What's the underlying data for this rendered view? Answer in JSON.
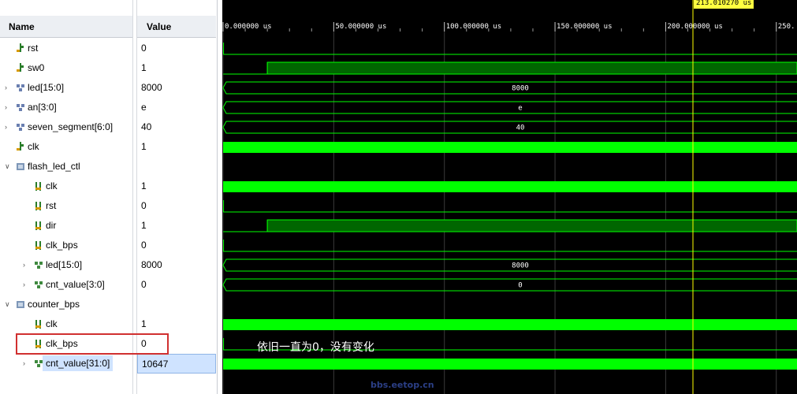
{
  "columns": {
    "name": "Name",
    "value": "Value"
  },
  "signals": [
    {
      "name": "rst",
      "value": "0",
      "indent": 0,
      "expand": "",
      "icon": "bit-signal-icon"
    },
    {
      "name": "sw0",
      "value": "1",
      "indent": 0,
      "expand": "",
      "icon": "bit-signal-icon"
    },
    {
      "name": "led[15:0]",
      "value": "8000",
      "indent": 0,
      "expand": ">",
      "icon": "bus-signal-icon"
    },
    {
      "name": "an[3:0]",
      "value": "e",
      "indent": 0,
      "expand": ">",
      "icon": "bus-signal-icon"
    },
    {
      "name": "seven_segment[6:0]",
      "value": "40",
      "indent": 0,
      "expand": ">",
      "icon": "bus-signal-icon"
    },
    {
      "name": "clk",
      "value": "1",
      "indent": 0,
      "expand": "",
      "icon": "bit-signal-icon"
    },
    {
      "name": "flash_led_ctl",
      "value": "",
      "indent": 0,
      "expand": "v",
      "icon": "module-icon"
    },
    {
      "name": "clk",
      "value": "1",
      "indent": 1,
      "expand": "",
      "icon": "internal-bit-icon"
    },
    {
      "name": "rst",
      "value": "0",
      "indent": 1,
      "expand": "",
      "icon": "internal-bit-icon"
    },
    {
      "name": "dir",
      "value": "1",
      "indent": 1,
      "expand": "",
      "icon": "internal-bit-icon"
    },
    {
      "name": "clk_bps",
      "value": "0",
      "indent": 1,
      "expand": "",
      "icon": "internal-bit-icon"
    },
    {
      "name": "led[15:0]",
      "value": "8000",
      "indent": 1,
      "expand": ">",
      "icon": "internal-bus-icon"
    },
    {
      "name": "cnt_value[3:0]",
      "value": "0",
      "indent": 1,
      "expand": ">",
      "icon": "internal-bus-icon"
    },
    {
      "name": "counter_bps",
      "value": "",
      "indent": 0,
      "expand": "v",
      "icon": "module-icon"
    },
    {
      "name": "clk",
      "value": "1",
      "indent": 1,
      "expand": "",
      "icon": "internal-bit-icon"
    },
    {
      "name": "clk_bps",
      "value": "0",
      "indent": 1,
      "expand": "",
      "icon": "internal-bit-icon"
    },
    {
      "name": "cnt_value[31:0]",
      "value": "10647",
      "indent": 1,
      "expand": ">",
      "icon": "internal-bus-icon",
      "selected": true
    }
  ],
  "timeline": {
    "unit": "us",
    "ticks": [
      "0.000000 us",
      "50.000000 us",
      "100.000000 us",
      "150.000000 us",
      "200.000000 us",
      "250."
    ],
    "cursor_label": "213.010270 us"
  },
  "waves": [
    {
      "type": "bit",
      "level": 0,
      "rise_at_us": 0.2
    },
    {
      "type": "bit",
      "level": 0,
      "rise_at_us": 20
    },
    {
      "type": "bus",
      "value": "8000"
    },
    {
      "type": "bus",
      "value": "e"
    },
    {
      "type": "bus",
      "value": "40"
    },
    {
      "type": "clock"
    },
    {
      "type": "empty"
    },
    {
      "type": "clock"
    },
    {
      "type": "bit",
      "level": 0,
      "rise_at_us": 0.2
    },
    {
      "type": "bit",
      "level": 0,
      "rise_at_us": 20
    },
    {
      "type": "bit",
      "level": 0,
      "rise_at_us": 0.2
    },
    {
      "type": "bus",
      "value": "8000"
    },
    {
      "type": "bus",
      "value": "0"
    },
    {
      "type": "empty"
    },
    {
      "type": "clock"
    },
    {
      "type": "bit",
      "level": 0,
      "rise_at_us": 0.2
    },
    {
      "type": "clock"
    }
  ],
  "annotation": "依旧一直为0，没有变化",
  "watermark": "bbs.eetop.cn",
  "colors": {
    "wave": "#00ff00",
    "wave_dark": "#006600",
    "cursor": "#ffff00",
    "grid": "#3a3a3a",
    "highlight": "#d03030"
  }
}
